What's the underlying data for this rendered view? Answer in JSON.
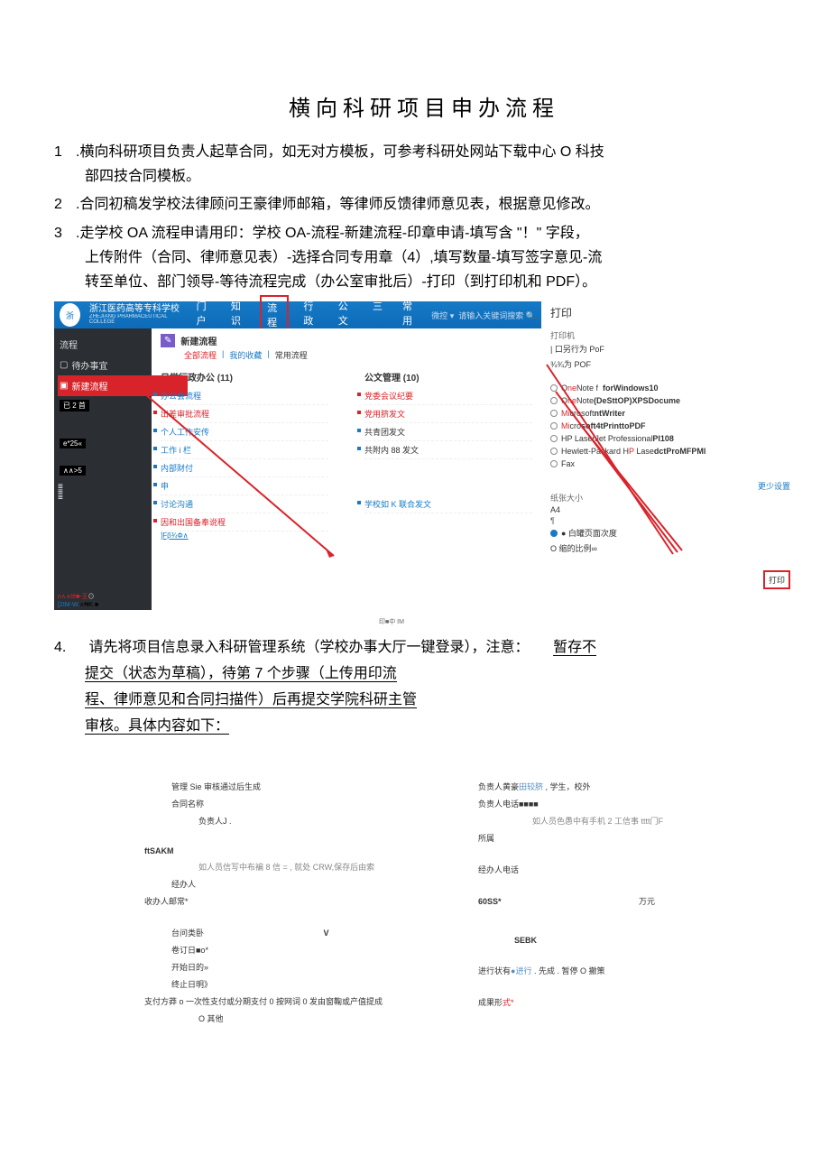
{
  "title": "横向科研项目申办流程",
  "steps": {
    "s1_num": "1",
    "s1_text": ".横向科研项目负责人起草合同，如无对方模板，可参考科研处网站下载中心 O 科技",
    "s1_text2": "部四技合同模板。",
    "s2_num": "2",
    "s2_text": ".合同初稿发学校法律顾问王豪律师邮箱，等律师反馈律师意见表，根据意见修改。",
    "s3_num": "3",
    "s3_line1": ".走学校 OA 流程申请用印：学校 OA-流程-新建流程-印章申请-填写含 \"！\" 字段，",
    "s3_line2": "上传附件（合同、律师意见表）-选择合同专用章（4）,填写数量-填写签字意见-流",
    "s3_line3": "转至单位、部门领导-等待流程完成（办公室审批后）-打印（到打印机和 PDF）。",
    "s4_num": "4.",
    "s4_p1a": "请先将项目信息录入科研管理系统（学校办事大厅一键登录），注意：",
    "s4_p1b": "暂存不",
    "s4_p2": "提交（状态为草稿），待第 7 个步骤（上传用印流",
    "s4_p3": "程、律师意见和合同扫描件）后再提交学院科研主管",
    "s4_p4": "审核。具体内容如下："
  },
  "oa": {
    "school_cn": "浙江医药高等专科学校",
    "school_en": "ZHEJIANG PHARMACEUTICAL COLLEGE",
    "nav": [
      "门户",
      "知识",
      "流程",
      "行政",
      "公文",
      "三",
      "常用"
    ],
    "micro": "微控 ▾",
    "search": "请输入关键词搜索",
    "side_label": "流程",
    "side_item1": "待办事宜",
    "side_item2": "新建流程",
    "side_tag1": "已 2 首",
    "side_tag2": "e*25«",
    "side_tag3": "∧∧>5",
    "side_foot1": "n∧∧ttt■-王",
    "side_foot2": "[2IM-W.",
    "main_badge": "新建流程",
    "main_sub": [
      "全部流程",
      "我的收藏",
      "常用流程"
    ],
    "col1_title": "日常行政办公 (11)",
    "col1_items": [
      "办公会流程",
      "出差审批流程",
      "个人工作安传",
      "工作 i 栏",
      "内部财付",
      "申",
      "讨论沟通",
      "因和出国备奉说程"
    ],
    "col1_foot": "]Fβ¾Φ∧",
    "col2_title": "公文管理 (10)",
    "col2_items": [
      "党委会议纪要",
      "党用脐发文",
      "共青团发文",
      "共附内 88 发文",
      "学校如 K 联合发文"
    ],
    "bottom_note": "印■中 IM"
  },
  "printer": {
    "hdr": "打印",
    "printer_lbl": "打印机",
    "save_behavior": "| 口另行为 PoF",
    "save_pdf": "¾¾为 POF",
    "opts": [
      "OneNote f  forWindows10",
      "OneNote(DeSttOP)XPSDocume",
      "MicrosoftntWriter",
      "Microsoft4tPrinttoPDF",
      "HP LaserJet ProfessionalPl108",
      "Hewlett-Packard HP LasedctProMFPMl",
      "Fax"
    ],
    "more": "更少设置",
    "paper": "纸张大小",
    "a4": "A4",
    "fit1": "● 白罐页面次度",
    "fit2": "O 缩的比例∞",
    "btn": "打印"
  },
  "form": {
    "left": {
      "r1": "管理 Sie 审核通过后生成",
      "r2": "合同名称",
      "r3": "负责人J .",
      "r4": "ftSAKM",
      "r4_note": "如人员信写中布褊 8 信 = , 就处 CRW,保存后由索",
      "r5": "经办人",
      "r6": "收办人邮常*",
      "r7": "台问类卧",
      "r7v": "V",
      "r8": "卷订日■o*",
      "r9": "开始日的»",
      "r10": "终止日明》",
      "r11": "支付方莽 o 一次性支付或分期支付 0 按网词 0 发由窗鞠或产值提成",
      "r11b": "O 其他"
    },
    "right": {
      "r1": "负责人黄豪田较脐 , 学生，校外",
      "r2": "负责人电话■■■■",
      "r2_note": "如人员色愚中有手机 2 工信事 tttt门F",
      "r3": "所属",
      "r4": "经办人电话",
      "r5l": "60SS*",
      "r5r": "万元",
      "r6": "SEBK",
      "r7": "进行状有●",
      "r7b": "进行 .  先成 .  暂停  O 撤策",
      "r8": "成果形式*"
    }
  }
}
